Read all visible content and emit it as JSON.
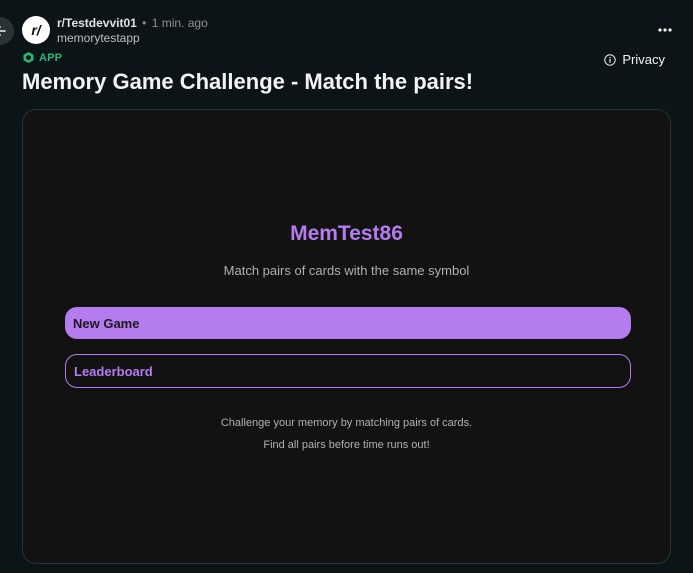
{
  "post": {
    "subreddit": "r/Testdevvit01",
    "separator": "•",
    "time": "1 min. ago",
    "author": "memorytestapp",
    "avatar_text": "r/",
    "badge": "APP",
    "privacy_label": "Privacy",
    "title": "Memory Game Challenge - Match the pairs!"
  },
  "icons": {
    "back": "arrow-left-icon",
    "more": "more-horizontal-icon",
    "app": "app-cube-icon",
    "info": "info-icon"
  },
  "game": {
    "title": "MemTest86",
    "subtitle": "Match pairs of cards with the same symbol",
    "new_game_label": "New Game",
    "leaderboard_label": "Leaderboard",
    "footer_line1": "Challenge your memory by matching pairs of cards.",
    "footer_line2": "Find all pairs before time runs out!"
  },
  "colors": {
    "background": "#0b1416",
    "accent": "#b57cf0",
    "app_badge": "#2bb673",
    "frame": "#121212"
  }
}
